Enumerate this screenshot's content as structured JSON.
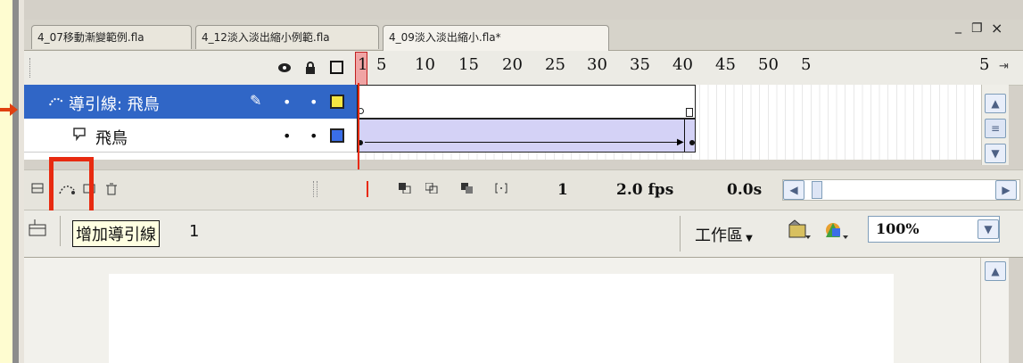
{
  "tabs": [
    {
      "label": "4_07移動漸變範例.fla"
    },
    {
      "label": "4_12淡入淡出縮小例範.fla"
    },
    {
      "label": "4_09淡入淡出縮小.fla*"
    }
  ],
  "window_controls": {
    "minimize": "_",
    "restore": "❐",
    "close": "×"
  },
  "ruler": {
    "current_frame": "1",
    "marks": [
      "5",
      "10",
      "15",
      "20",
      "25",
      "30",
      "35",
      "40",
      "45",
      "50",
      "5"
    ]
  },
  "layers": [
    {
      "name": "導引線: 飛鳥",
      "selected": true,
      "color": "#f5e642"
    },
    {
      "name": "飛鳥",
      "selected": false,
      "color": "#3a6ee8"
    }
  ],
  "status": {
    "frame": "1",
    "fps": "2.0 fps",
    "time": "0.0s"
  },
  "tooltip": {
    "text": "增加導引線"
  },
  "tooltip_suffix": "1",
  "workspace": {
    "label": "工作區"
  },
  "zoom": {
    "value": "100%"
  },
  "colors": {
    "accent_red": "#e82a10",
    "layer_selected": "#3066c6",
    "arrow": "#e04010"
  }
}
